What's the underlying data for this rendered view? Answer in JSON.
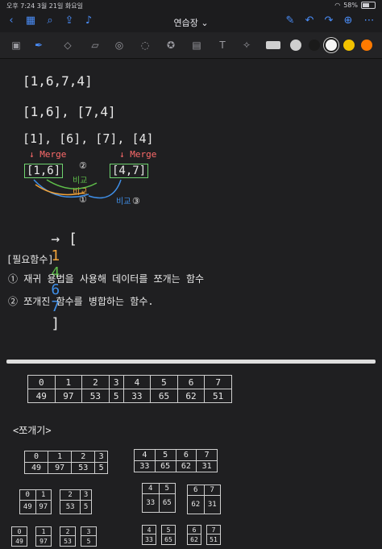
{
  "status": {
    "time": "오후 7:24",
    "date": "3월 21일 화요일",
    "battery": "58%"
  },
  "header": {
    "title": "연습장"
  },
  "toolbar": {
    "colors": [
      "#cfcfcf",
      "#1a1a1a",
      "#f5f5f5",
      "#f2c200",
      "#ff7a00"
    ]
  },
  "note": {
    "line1": "[1,6,7,4]",
    "line2": "[1,6], [7,4]",
    "line3": "[1], [6], [7], [4]",
    "merge_left": "↓ Merge",
    "merge_right": "↓ Merge",
    "box_left": "[1,6]",
    "box_right": "[4,7]",
    "circ1": "①",
    "circ2": "②",
    "circ3": "③",
    "compare_green": "비교",
    "compare_orange": "비교",
    "compare_blue": "비교",
    "result_open": "→ [",
    "result_vals": [
      "1",
      "4",
      "6",
      "7"
    ],
    "result_colors": [
      "#f2a33a",
      "#5fbf4a",
      "#3f8fe8",
      "#3f8fe8"
    ],
    "result_close": "]",
    "section_title": "[필요함수]",
    "item1": "① 재귀 용법을 사용해 데이터를 쪼개는 함수",
    "item2": "② 쪼개진 함수를 병합하는 함수."
  },
  "table_main": {
    "top": [
      "0",
      "1",
      "2",
      "3",
      "4",
      "5",
      "6",
      "7"
    ],
    "bottom": [
      "49",
      "97",
      "53",
      "5",
      "33",
      "65",
      "62",
      "51"
    ]
  },
  "split_label": "<쪼개기>",
  "half_left": {
    "top": [
      "0",
      "1",
      "2",
      "3"
    ],
    "bottom": [
      "49",
      "97",
      "53",
      "5"
    ]
  },
  "half_right": {
    "top": [
      "4",
      "5",
      "6",
      "7"
    ],
    "bottom": [
      "33",
      "65",
      "62",
      "31"
    ]
  },
  "quarters": [
    {
      "top": [
        "0",
        "1"
      ],
      "bottom": [
        "49",
        "97"
      ]
    },
    {
      "top": [
        "2",
        "3"
      ],
      "bottom": [
        "53",
        "5"
      ]
    },
    {
      "top": [
        "4",
        "5"
      ],
      "bottom": [
        "33",
        "65"
      ]
    },
    {
      "top": [
        "6",
        "7"
      ],
      "bottom": [
        "62",
        "31"
      ]
    }
  ],
  "singles": [
    {
      "top": "0",
      "bottom": "49"
    },
    {
      "top": "1",
      "bottom": "97"
    },
    {
      "top": "2",
      "bottom": "53"
    },
    {
      "top": "3",
      "bottom": "5"
    },
    {
      "top": "4",
      "bottom": "33"
    },
    {
      "top": "5",
      "bottom": "65"
    },
    {
      "top": "6",
      "bottom": "62"
    },
    {
      "top": "7",
      "bottom": "51"
    }
  ]
}
